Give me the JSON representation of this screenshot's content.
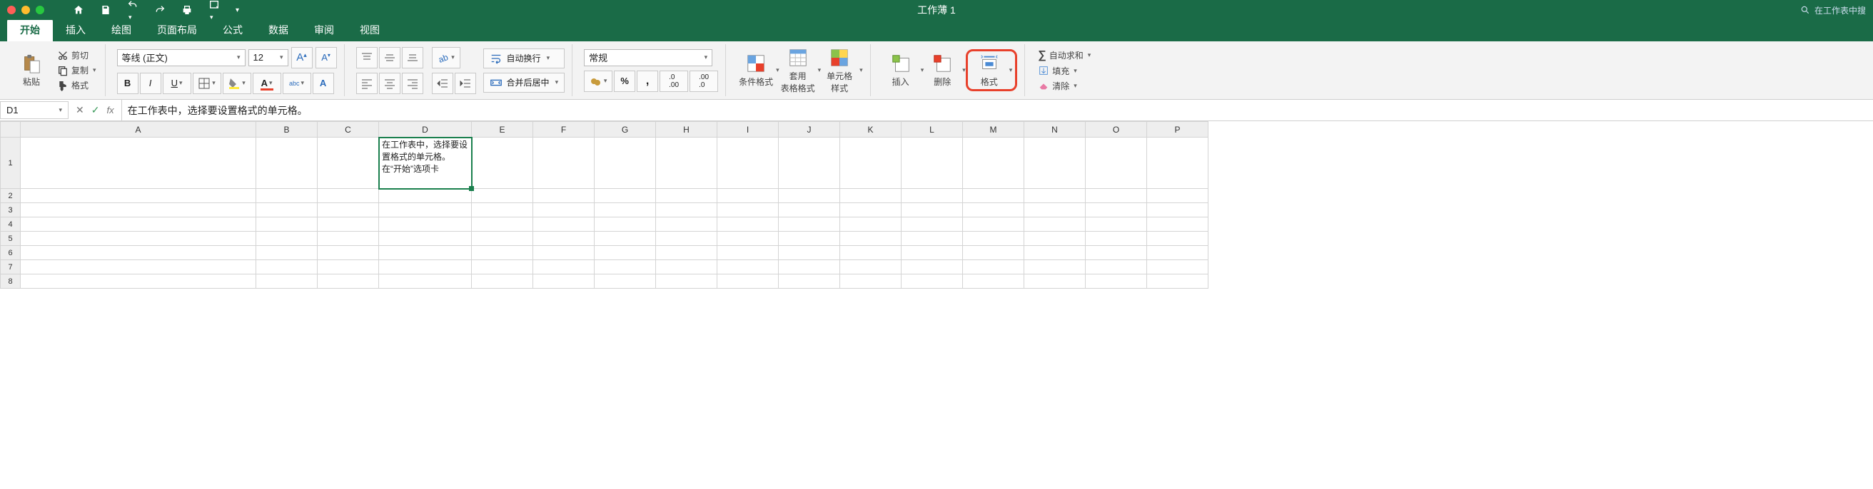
{
  "title": "工作薄 1",
  "search_placeholder": "在工作表中搜",
  "tabs": [
    "开始",
    "插入",
    "绘图",
    "页面布局",
    "公式",
    "数据",
    "审阅",
    "视图"
  ],
  "active_tab": 0,
  "clipboard": {
    "cut": "剪切",
    "copy": "复制",
    "format": "格式",
    "paste": "粘贴"
  },
  "font": {
    "name": "等线 (正文)",
    "size": "12"
  },
  "align_buttons": {
    "wrap": "自动换行",
    "merge": "合并后居中"
  },
  "number_format": "常规",
  "styles": {
    "cond": "条件格式",
    "table": "套用\n表格格式",
    "cell": "单元格\n样式"
  },
  "cells": {
    "insert": "插入",
    "delete": "删除",
    "format": "格式"
  },
  "editing": {
    "sum": "自动求和",
    "fill": "填充",
    "clear": "清除"
  },
  "namebox": "D1",
  "formula": "在工作表中，选择要设置格式的单元格。",
  "columns": [
    "A",
    "B",
    "C",
    "D",
    "E",
    "F",
    "G",
    "H",
    "I",
    "J",
    "K",
    "L",
    "M",
    "N",
    "O",
    "P"
  ],
  "rows": 8,
  "selected_cell_text": "在工作表中，选择要设置格式的单元格。\n在“开始”选项卡"
}
